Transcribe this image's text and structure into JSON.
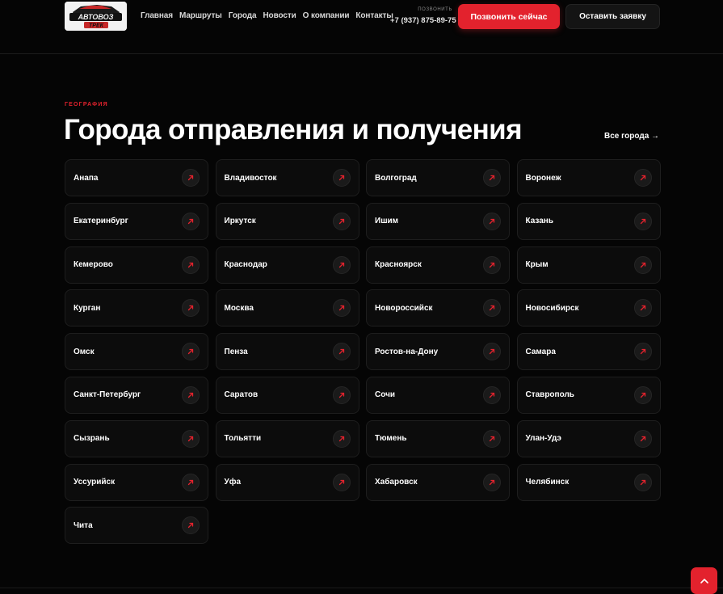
{
  "header": {
    "logo_text": "АВТОВОЗ ТРЕК",
    "nav": [
      "Главная",
      "Маршруты",
      "Города",
      "Новости",
      "О компании",
      "Контакты"
    ],
    "phone_label": "ПОЗВОНИТЬ",
    "phone": "+7 (937) 875-89-75",
    "call_button": "Позвонить сейчас",
    "request_button": "Оставить заявку"
  },
  "section": {
    "eyebrow": "ГЕОГРАФИЯ",
    "title": "Города отправления и получения",
    "all_cities": "Все города →"
  },
  "cities": [
    "Анапа",
    "Владивосток",
    "Волгоград",
    "Воронеж",
    "Екатеринбург",
    "Иркутск",
    "Ишим",
    "Казань",
    "Кемерово",
    "Краснодар",
    "Красноярск",
    "Крым",
    "Курган",
    "Москва",
    "Новороссийск",
    "Новосибирск",
    "Омск",
    "Пенза",
    "Ростов-на-Дону",
    "Самара",
    "Санкт-Петербург",
    "Саратов",
    "Сочи",
    "Ставрополь",
    "Сызрань",
    "Тольятти",
    "Тюмень",
    "Улан-Удэ",
    "Уссурийск",
    "Уфа",
    "Хабаровск",
    "Челябинск",
    "Чита"
  ],
  "icons": {
    "card_arrow": "arrow-up-right-icon",
    "scroll_top": "chevron-up-icon"
  },
  "colors": {
    "accent": "#e3222d",
    "background": "#050505",
    "card": "#0c0c0c"
  }
}
